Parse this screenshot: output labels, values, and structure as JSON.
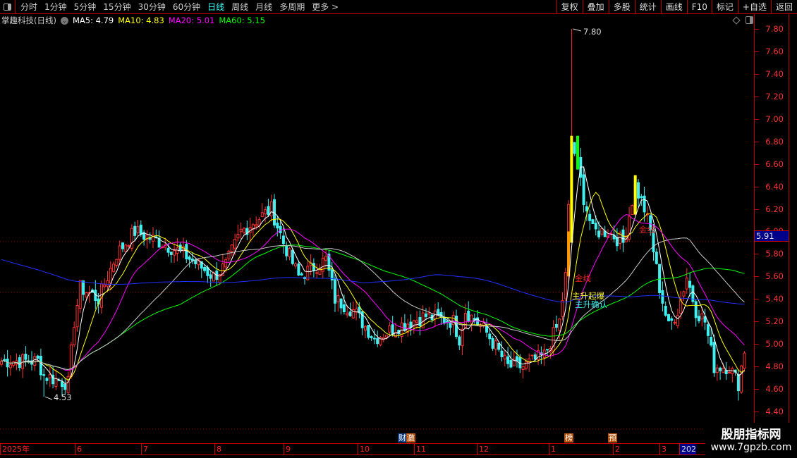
{
  "toolbar": {
    "tabs": [
      "分时",
      "1分钟",
      "5分钟",
      "15分钟",
      "30分钟",
      "60分钟",
      "日线",
      "周线",
      "月线",
      "多周期",
      "更多 >"
    ],
    "active": "日线",
    "right_buttons": [
      "复权",
      "叠加",
      "多股",
      "统计",
      "画线",
      "F10",
      "标记",
      "+自选",
      "返回"
    ]
  },
  "info": {
    "title": "掌趣科技(日线)",
    "ma5": "MA5: 4.79",
    "ma10": "MA10: 4.83",
    "ma20": "MA20: 5.01",
    "ma60": "MA60: 5.15"
  },
  "colors": {
    "up": "#ff3030",
    "down": "#40f0f0",
    "ma5": "#ffffff",
    "ma10": "#ffff00",
    "ma20": "#ff00ff",
    "ma60": "#00ff00",
    "ma_long": "#2030ff",
    "ma_mid": "#c8c8c8"
  },
  "axis": {
    "ticks": [
      "7.80",
      "7.60",
      "7.40",
      "7.20",
      "7.00",
      "6.80",
      "6.60",
      "6.40",
      "6.20",
      "6.00",
      "5.80",
      "5.60",
      "5.40",
      "5.20",
      "5.00",
      "4.80",
      "4.60",
      "4.40"
    ],
    "current": "5.91"
  },
  "annotations": {
    "high": "7.80",
    "low": "4.53",
    "gold": "金线",
    "gold2": "金线",
    "start": "主升起爆",
    "confirm": "主升确认"
  },
  "signals": [
    "财",
    "激",
    "榜",
    "预"
  ],
  "dates": [
    "2025年",
    "6",
    "7",
    "8",
    "9",
    "10",
    "11",
    "12",
    "1",
    "2",
    "3",
    "202"
  ],
  "watermark": {
    "line1": "股朋指标网",
    "line2": "www.7gpzb.com"
  },
  "chart_data": {
    "type": "candlestick",
    "ylim": [
      4.4,
      7.8
    ],
    "days": 246,
    "close_keyframes": [
      [
        0,
        4.85
      ],
      [
        12,
        4.85
      ],
      [
        14,
        4.72
      ],
      [
        22,
        4.65
      ],
      [
        24,
        5.2
      ],
      [
        26,
        5.5
      ],
      [
        32,
        5.4
      ],
      [
        38,
        5.8
      ],
      [
        44,
        6.0
      ],
      [
        53,
        5.9
      ],
      [
        60,
        5.8
      ],
      [
        70,
        5.6
      ],
      [
        74,
        5.7
      ],
      [
        79,
        6.0
      ],
      [
        89,
        6.2
      ],
      [
        93,
        5.9
      ],
      [
        98,
        5.6
      ],
      [
        107,
        5.75
      ],
      [
        110,
        5.4
      ],
      [
        116,
        5.3
      ],
      [
        123,
        5.05
      ],
      [
        130,
        5.15
      ],
      [
        140,
        5.25
      ],
      [
        149,
        5.2
      ],
      [
        151,
        5.05
      ],
      [
        153,
        5.3
      ],
      [
        160,
        5.1
      ],
      [
        167,
        4.8
      ],
      [
        172,
        4.8
      ],
      [
        179,
        4.9
      ],
      [
        184,
        5.2
      ],
      [
        186,
        5.6
      ],
      [
        188,
        6.8
      ],
      [
        190,
        6.6
      ],
      [
        192,
        6.3
      ],
      [
        195,
        6.0
      ],
      [
        200,
        6.0
      ],
      [
        205,
        5.9
      ],
      [
        209,
        6.4
      ],
      [
        212,
        6.2
      ],
      [
        214,
        6.0
      ],
      [
        217,
        5.5
      ],
      [
        220,
        5.15
      ],
      [
        223,
        5.3
      ],
      [
        226,
        5.6
      ],
      [
        229,
        5.3
      ],
      [
        232,
        5.2
      ],
      [
        235,
        4.8
      ],
      [
        240,
        4.8
      ],
      [
        243,
        4.65
      ],
      [
        245,
        4.95
      ]
    ],
    "high": {
      "day": 188,
      "value": 7.8
    },
    "low": {
      "day": 14,
      "value": 4.53
    }
  }
}
